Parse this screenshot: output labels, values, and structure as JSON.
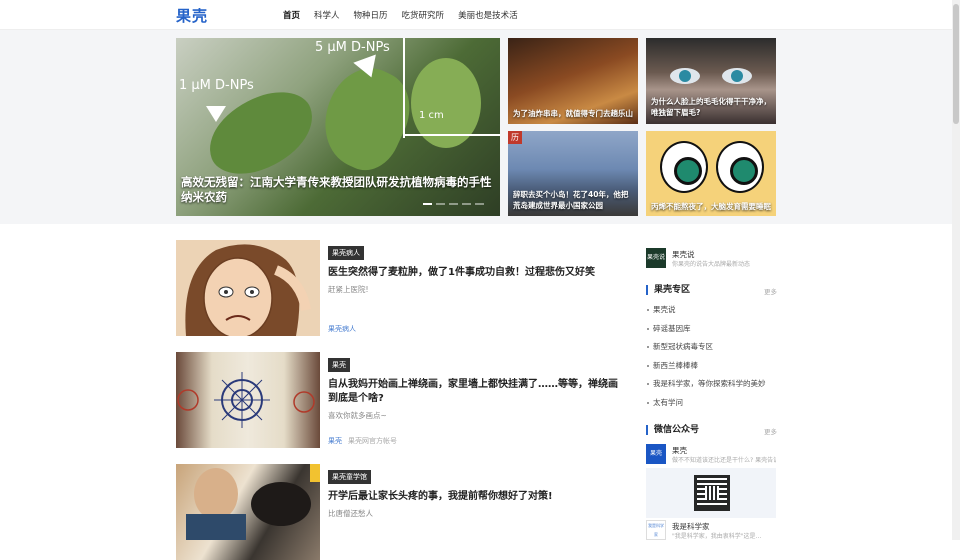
{
  "header": {
    "logo": "果壳",
    "nav": [
      "首页",
      "科学人",
      "物种日历",
      "吃货研究所",
      "美丽也是技术活"
    ]
  },
  "hero": {
    "main": {
      "caption": "高效无残留：江南大学青传来教授团队研发抗植物病毒的手性纳米农药",
      "overlay_left": "1 μM D-NPs",
      "overlay_right": "5 μM D-NPs",
      "overlay_scale": "1 cm"
    },
    "tiles": [
      {
        "caption": "为了油炸串串，就值得专门去趟乐山"
      },
      {
        "caption": "为什么人脸上的毛毛化得干干净净，唯独留下眉毛?"
      },
      {
        "caption": "辞职去买个小岛！花了40年，他把荒岛建成世界最小国家公园",
        "tag": "历"
      },
      {
        "caption": "丙烯不能熬夜了，大脑发育需要睡眠"
      }
    ]
  },
  "articles": [
    {
      "badge": "果壳病人",
      "title": "医生突然得了麦粒肿，做了1件事成功自救！过程悲伤又好笑",
      "desc": "赶紧上医院!",
      "source": "果壳病人",
      "extra": ""
    },
    {
      "badge": "果壳",
      "title": "自从我妈开始画上禅绕画，家里墙上都快挂满了……等等，禅绕画到底是个啥?",
      "desc": "喜欢你就多画点~",
      "source": "果壳",
      "extra": "果壳网官方帐号"
    },
    {
      "badge": "果壳童学馆",
      "title": "开学后最让家长头疼的事，我提前帮你想好了对策!",
      "desc": "比唐僧还愁人",
      "source": "",
      "extra": ""
    }
  ],
  "sidebar": {
    "account": {
      "avatar": "果壳说",
      "name": "果壳说",
      "sub": "你果壳的说告大品牌最新动态"
    },
    "zone": {
      "title": "果壳专区",
      "more": "更多",
      "items": [
        "果壳说",
        "碎谣基因库",
        "新型冠状病毒专区",
        "新西兰棒棒棒",
        "我是科学家，等你探索科学的美妙",
        "太有学问"
      ]
    },
    "wechat": {
      "title": "微信公众号",
      "more": "更多",
      "items": [
        {
          "avatar": "果壳",
          "name": "果壳",
          "sub": "做不不知道该还比还是干什么? 果壳告诉你"
        },
        {
          "avatar": "我是科学家",
          "name": "我是科学家",
          "sub": "\"我是科学家，我由衷科学\"这是…"
        }
      ]
    }
  }
}
